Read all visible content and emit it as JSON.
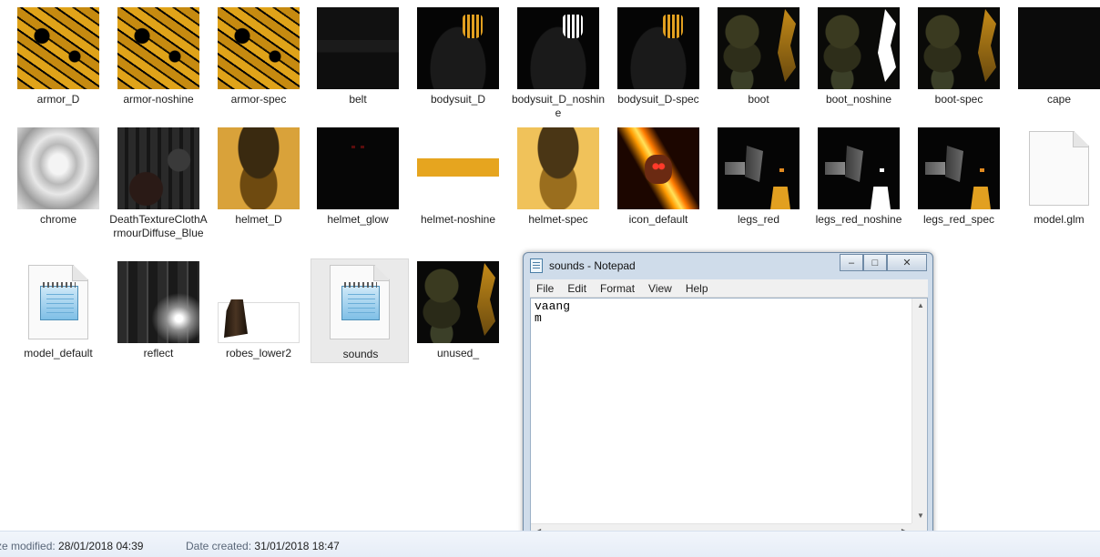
{
  "files": [
    {
      "name": "armor_D",
      "icon": "texture-thumbnail"
    },
    {
      "name": "armor-noshine",
      "icon": "texture-thumbnail"
    },
    {
      "name": "armor-spec",
      "icon": "texture-thumbnail"
    },
    {
      "name": "belt",
      "icon": "texture-thumbnail"
    },
    {
      "name": "bodysuit_D",
      "icon": "texture-thumbnail"
    },
    {
      "name": "bodysuit_D_noshine",
      "icon": "texture-thumbnail"
    },
    {
      "name": "bodysuit_D-spec",
      "icon": "texture-thumbnail"
    },
    {
      "name": "boot",
      "icon": "texture-thumbnail"
    },
    {
      "name": "boot_noshine",
      "icon": "texture-thumbnail"
    },
    {
      "name": "boot-spec",
      "icon": "texture-thumbnail"
    },
    {
      "name": "cape",
      "icon": "texture-thumbnail"
    },
    {
      "name": "chrome",
      "icon": "texture-thumbnail"
    },
    {
      "name": "DeathTextureClothArmourDiffuse_Blue",
      "icon": "texture-thumbnail"
    },
    {
      "name": "helmet_D",
      "icon": "texture-thumbnail"
    },
    {
      "name": "helmet_glow",
      "icon": "texture-thumbnail"
    },
    {
      "name": "helmet-noshine",
      "icon": "texture-thumbnail"
    },
    {
      "name": "helmet-spec",
      "icon": "texture-thumbnail"
    },
    {
      "name": "icon_default",
      "icon": "texture-thumbnail"
    },
    {
      "name": "legs_red",
      "icon": "texture-thumbnail"
    },
    {
      "name": "legs_red_noshine",
      "icon": "texture-thumbnail"
    },
    {
      "name": "legs_red_spec",
      "icon": "texture-thumbnail"
    },
    {
      "name": "model.glm",
      "icon": "generic-file-icon"
    },
    {
      "name": "model_default",
      "icon": "notepad-file-icon"
    },
    {
      "name": "reflect",
      "icon": "texture-thumbnail"
    },
    {
      "name": "robes_lower2",
      "icon": "texture-thumbnail"
    },
    {
      "name": "sounds",
      "icon": "notepad-file-icon",
      "selected": true
    },
    {
      "name": "unused_",
      "icon": "texture-thumbnail"
    }
  ],
  "notepad": {
    "title": "sounds - Notepad",
    "menu": [
      "File",
      "Edit",
      "Format",
      "View",
      "Help"
    ],
    "content": "vaang\nm",
    "buttons": {
      "minimize": "–",
      "maximize": "□",
      "close": "✕"
    }
  },
  "details": {
    "modified_label": "ze modified:",
    "modified_value": "28/01/2018 04:39",
    "created_label": "Date created:",
    "created_value": "31/01/2018 18:47"
  }
}
